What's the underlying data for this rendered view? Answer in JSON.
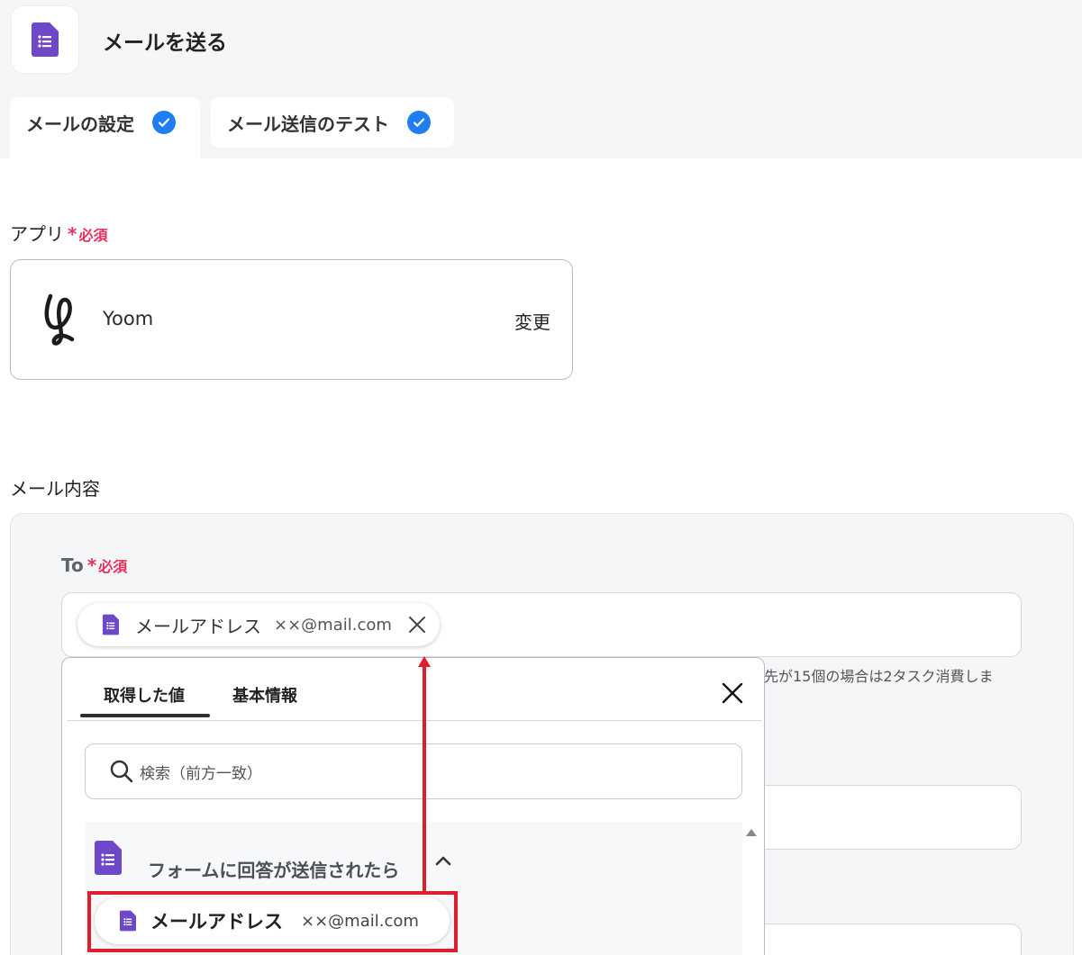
{
  "header": {
    "title": "メールを送る"
  },
  "tabs": [
    {
      "label": "メールの設定"
    },
    {
      "label": "メール送信のテスト"
    }
  ],
  "app_section": {
    "label": "アプリ",
    "required_label": "必須",
    "app_name": "Yoom",
    "change_label": "変更"
  },
  "mail_section": {
    "label": "メール内容",
    "to": {
      "label": "To",
      "required_label": "必須",
      "chip_label": "メールアドレス",
      "chip_value": "××@mail.com",
      "hint": "先が15個の場合は2タスク消費しま"
    }
  },
  "popup": {
    "tabs": [
      "取得した値",
      "基本情報"
    ],
    "search_placeholder": "検索（前方一致）",
    "group_title": "フォームに回答が送信されたら",
    "item_label": "メールアドレス",
    "item_value": "××@mail.com"
  },
  "colors": {
    "form_purple": "#6f48c9",
    "check_blue": "#1f7ff2",
    "required_red": "#e4315b",
    "annotation_red": "#e01e2b"
  }
}
